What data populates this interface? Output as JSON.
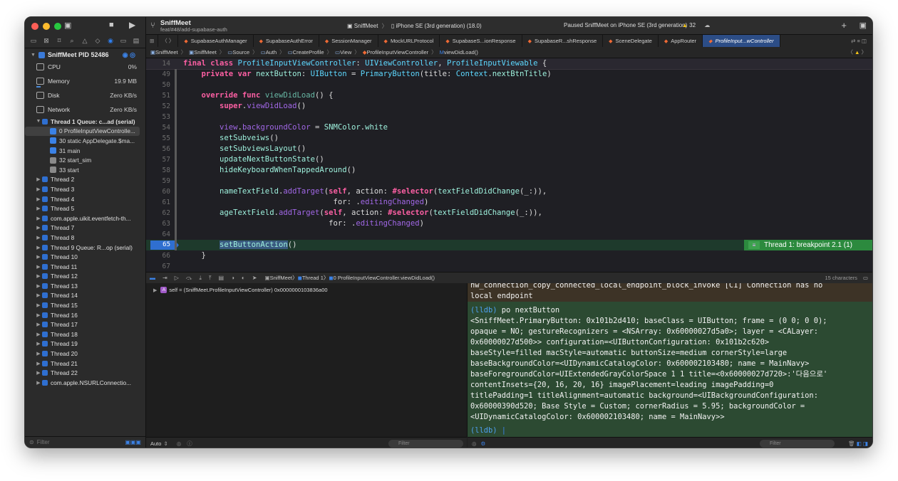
{
  "window": {
    "project": "SniffMeet",
    "branch": "feat/#48/add-supabase-auth",
    "scheme": "SniffMeet",
    "destination": "iPhone SE (3rd generation) (18.0)",
    "status": "Paused SniffMeet on iPhone SE (3rd generation)",
    "warning_count": "32"
  },
  "navigator": {
    "process": "SniffMeet PID 52486",
    "gauges": [
      {
        "label": "CPU",
        "value": "0%"
      },
      {
        "label": "Memory",
        "value": "19.9 MB"
      },
      {
        "label": "Disk",
        "value": "Zero KB/s"
      },
      {
        "label": "Network",
        "value": "Zero KB/s"
      }
    ],
    "thread1": "Thread 1 Queue: c...ad (serial)",
    "frames": [
      {
        "label": "0 ProfileInputViewControlle...",
        "icon": "user-icon",
        "selected": true
      },
      {
        "label": "30 static AppDelegate.$ma...",
        "icon": "user-icon",
        "selected": false
      },
      {
        "label": "31 main",
        "icon": "user-icon",
        "selected": false
      },
      {
        "label": "32 start_sim",
        "icon": "system-icon",
        "selected": false
      },
      {
        "label": "33 start",
        "icon": "system-icon",
        "selected": false
      }
    ],
    "threads": [
      "Thread 2",
      "Thread 3",
      "Thread 4",
      "Thread 5",
      "com.apple.uikit.eventfetch-th...",
      "Thread 7",
      "Thread 8",
      "Thread 9 Queue: R...op (serial)",
      "Thread 10",
      "Thread 11",
      "Thread 12",
      "Thread 13",
      "Thread 14",
      "Thread 15",
      "Thread 16",
      "Thread 17",
      "Thread 18",
      "Thread 19",
      "Thread 20",
      "Thread 21",
      "Thread 22",
      "com.apple.NSURLConnectio..."
    ],
    "filter_placeholder": "Filter"
  },
  "tabs": [
    {
      "label": "SupabaseAuthManager",
      "active": false
    },
    {
      "label": "SupabaseAuthError",
      "active": false
    },
    {
      "label": "SessionManager",
      "active": false
    },
    {
      "label": "MockURLProtocol",
      "active": false
    },
    {
      "label": "SupabaseS...ionResponse",
      "active": false
    },
    {
      "label": "SupabaseR...shResponse",
      "active": false
    },
    {
      "label": "SceneDelegate",
      "active": false
    },
    {
      "label": "AppRouter",
      "active": false
    },
    {
      "label": "ProfileInput...wController",
      "active": true
    }
  ],
  "breadcrumb": [
    "SniffMeet",
    "SniffMeet",
    "Source",
    "Auth",
    "CreateProfile",
    "View",
    "ProfileInputViewController",
    "viewDidLoad()"
  ],
  "editor": {
    "lines": [
      {
        "n": "14",
        "sticky": true,
        "tokens": [
          [
            "kw",
            "final class "
          ],
          [
            "ty",
            "ProfileInputViewController"
          ],
          [
            "pl",
            ": "
          ],
          [
            "ty",
            "UIViewController"
          ],
          [
            "pl",
            ", "
          ],
          [
            "ty",
            "ProfileInputViewable"
          ],
          [
            "pl",
            " {"
          ]
        ]
      },
      {
        "n": "49",
        "tokens": [
          [
            "pl",
            "    "
          ],
          [
            "kw",
            "private var "
          ],
          [
            "ty2",
            "nextButton"
          ],
          [
            "pl",
            ": "
          ],
          [
            "ty",
            "UIButton"
          ],
          [
            "pl",
            " = "
          ],
          [
            "ty",
            "PrimaryButton"
          ],
          [
            "pl",
            "(title: "
          ],
          [
            "ty",
            "Context"
          ],
          [
            "pl",
            "."
          ],
          [
            "ty2",
            "nextBtnTitle"
          ],
          [
            "pl",
            ")"
          ]
        ]
      },
      {
        "n": "50",
        "tokens": []
      },
      {
        "n": "51",
        "tokens": [
          [
            "pl",
            "    "
          ],
          [
            "kw",
            "override func "
          ],
          [
            "fn",
            "viewDidLoad"
          ],
          [
            "pl",
            "() {"
          ]
        ]
      },
      {
        "n": "52",
        "tokens": [
          [
            "pl",
            "        "
          ],
          [
            "kw",
            "super"
          ],
          [
            "pl",
            "."
          ],
          [
            "tx",
            "viewDidLoad"
          ],
          [
            "pl",
            "()"
          ]
        ]
      },
      {
        "n": "53",
        "tokens": []
      },
      {
        "n": "54",
        "tokens": [
          [
            "pl",
            "        "
          ],
          [
            "tx",
            "view"
          ],
          [
            "pl",
            "."
          ],
          [
            "tx",
            "backgroundColor"
          ],
          [
            "pl",
            " = "
          ],
          [
            "ty2",
            "SNMColor"
          ],
          [
            "pl",
            "."
          ],
          [
            "ty2",
            "white"
          ]
        ]
      },
      {
        "n": "55",
        "tokens": [
          [
            "pl",
            "        "
          ],
          [
            "ty2",
            "setSubveiws"
          ],
          [
            "pl",
            "()"
          ]
        ]
      },
      {
        "n": "56",
        "tokens": [
          [
            "pl",
            "        "
          ],
          [
            "ty2",
            "setSubviewsLayout"
          ],
          [
            "pl",
            "()"
          ]
        ]
      },
      {
        "n": "57",
        "tokens": [
          [
            "pl",
            "        "
          ],
          [
            "ty2",
            "updateNextButtonState"
          ],
          [
            "pl",
            "()"
          ]
        ]
      },
      {
        "n": "58",
        "tokens": [
          [
            "pl",
            "        "
          ],
          [
            "ty2",
            "hideKeyboardWhenTappedAround"
          ],
          [
            "pl",
            "()"
          ]
        ]
      },
      {
        "n": "59",
        "tokens": []
      },
      {
        "n": "60",
        "tokens": [
          [
            "pl",
            "        "
          ],
          [
            "ty2",
            "nameTextField"
          ],
          [
            "pl",
            "."
          ],
          [
            "tx",
            "addTarget"
          ],
          [
            "pl",
            "("
          ],
          [
            "kw",
            "self"
          ],
          [
            "pl",
            ", action: "
          ],
          [
            "kw",
            "#selector"
          ],
          [
            "pl",
            "("
          ],
          [
            "ty2",
            "textFieldDidChange"
          ],
          [
            "pl",
            "(_:)),"
          ]
        ]
      },
      {
        "n": "61",
        "tokens": [
          [
            "pl",
            "                                 for: ."
          ],
          [
            "tx",
            "editingChanged"
          ],
          [
            "pl",
            ")"
          ]
        ]
      },
      {
        "n": "62",
        "tokens": [
          [
            "pl",
            "        "
          ],
          [
            "ty2",
            "ageTextField"
          ],
          [
            "pl",
            "."
          ],
          [
            "tx",
            "addTarget"
          ],
          [
            "pl",
            "("
          ],
          [
            "kw",
            "self"
          ],
          [
            "pl",
            ", action: "
          ],
          [
            "kw",
            "#selector"
          ],
          [
            "pl",
            "("
          ],
          [
            "ty2",
            "textFieldDidChange"
          ],
          [
            "pl",
            "(_:)),"
          ]
        ]
      },
      {
        "n": "63",
        "tokens": [
          [
            "pl",
            "                                for: ."
          ],
          [
            "tx",
            "editingChanged"
          ],
          [
            "pl",
            ")"
          ]
        ]
      },
      {
        "n": "64",
        "tokens": []
      },
      {
        "n": "65",
        "current": true,
        "tokens": [
          [
            "pl",
            "        "
          ],
          [
            "ty2",
            "setButtonAction"
          ],
          [
            "pl",
            "()"
          ]
        ]
      },
      {
        "n": "66",
        "tokens": [
          [
            "pl",
            "    }"
          ]
        ]
      },
      {
        "n": "67",
        "tokens": []
      }
    ],
    "breakpoint_annotation": "Thread 1: breakpoint 2.1 (1)"
  },
  "debugbar": {
    "path": [
      "SniffMeet",
      "Thread 1",
      "0 ProfileInputViewController.viewDidLoad()"
    ],
    "char_count": "15 characters"
  },
  "variables": {
    "row": "self = (SniffMeet.ProfileInputViewController) 0x0000000103836a00",
    "mode": "Auto",
    "filter_placeholder": "Filter"
  },
  "console": {
    "previous_output": [
      "nw_connection_copy_connected_local_endpoint_block_invoke [C1] Connection has no",
      "local endpoint"
    ],
    "command_prompt": "(lldb) ",
    "command": "po nextButton",
    "output": [
      "<SniffMeet.PrimaryButton: 0x101b2d410; baseClass = UIButton; frame = (0 0; 0 0);",
      "opaque = NO; gestureRecognizers = <NSArray: 0x60000027d5a0>; layer = <CALayer:",
      "0x60000027d500>> configuration=<UIButtonConfiguration: 0x101b2c620>",
      "baseStyle=filled macStyle=automatic buttonSize=medium cornerStyle=large",
      "baseBackgroundColor=<UIDynamicCatalogColor: 0x600002103480; name = MainNavy>",
      "baseForegroundColor=UIExtendedGrayColorSpace 1 1 title=<0x60000027d720>:'다음으로'",
      "contentInsets={20, 16, 20, 16} imagePlacement=leading imagePadding=0",
      "titlePadding=1 titleAlignment=automatic background=<UIBackgroundConfiguration:",
      "0x60000390d520; Base Style = Custom; cornerRadius = 5.95; backgroundColor =",
      "<UIDynamicCatalogColor: 0x600002103480; name = MainNavy>>"
    ],
    "final_prompt": "(lldb) ",
    "filter_placeholder": "Filter"
  },
  "colors": {
    "accent": "#2f6fd0",
    "console_bg": "#2c4a32",
    "breakpoint_green": "#2c8a3e"
  }
}
